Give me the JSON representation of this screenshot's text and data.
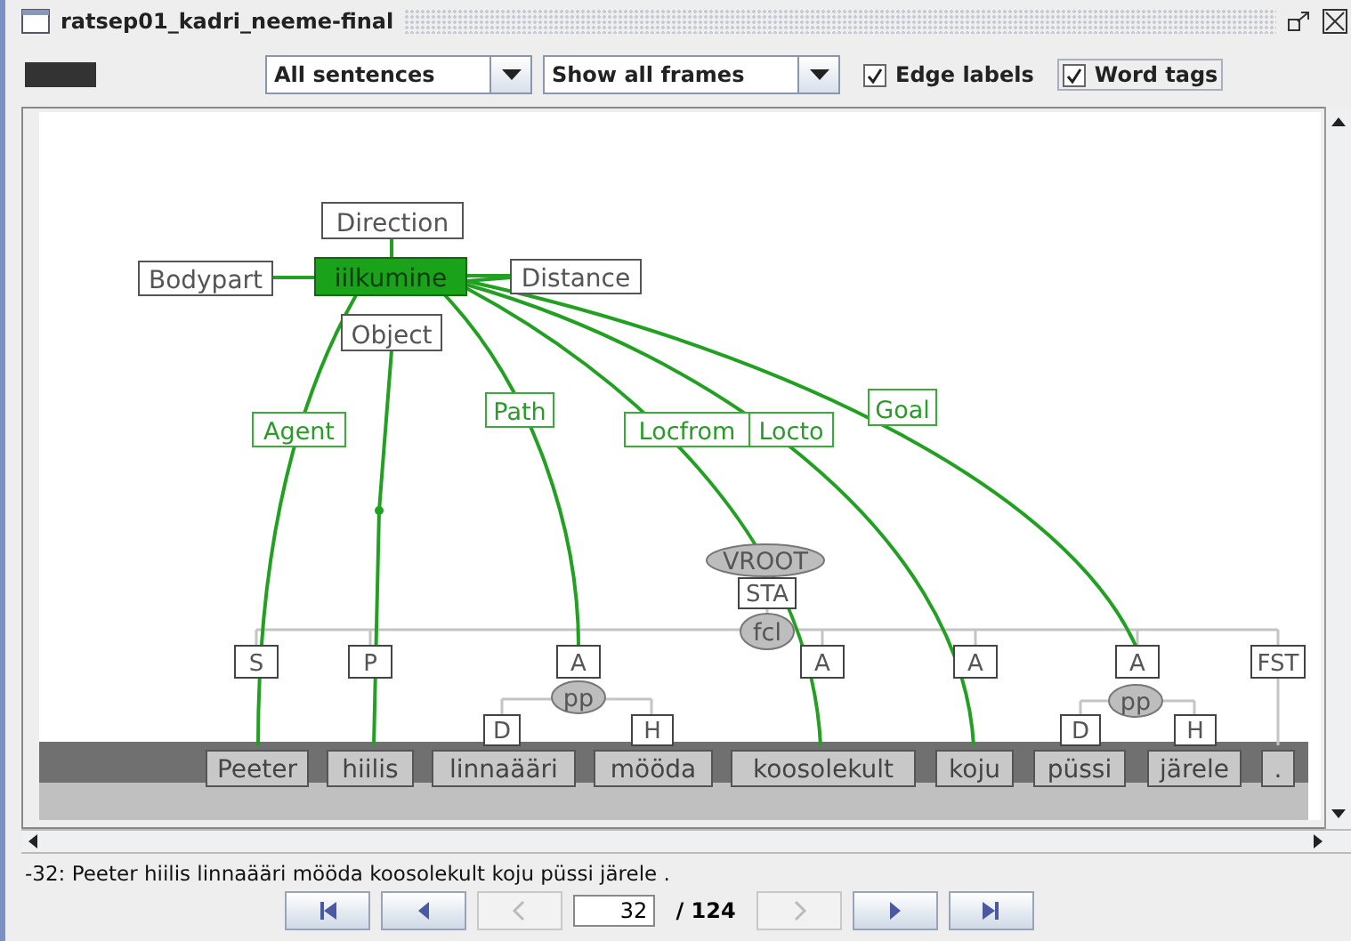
{
  "window": {
    "title": "ratsep01_kadri_neeme-final"
  },
  "toolbar": {
    "dropdowns": [
      {
        "value": "All sentences"
      },
      {
        "value": "Show all frames"
      }
    ],
    "checkboxes": [
      {
        "label": "Edge labels",
        "checked": true,
        "focused": false
      },
      {
        "label": "Word tags",
        "checked": true,
        "focused": true
      }
    ]
  },
  "frame_nodes": [
    {
      "text": "Direction",
      "kind": "element"
    },
    {
      "text": "Bodypart",
      "kind": "element"
    },
    {
      "text": "iilkumine",
      "kind": "frame"
    },
    {
      "text": "Distance",
      "kind": "element"
    },
    {
      "text": "Object",
      "kind": "element"
    }
  ],
  "edge_labels": [
    {
      "text": "Agent"
    },
    {
      "text": "Path"
    },
    {
      "text": "Locfrom"
    },
    {
      "text": "Locto"
    },
    {
      "text": "Goal"
    }
  ],
  "syntax_nodes": [
    {
      "text": "VROOT",
      "kind": "phrase"
    },
    {
      "text": "STA",
      "kind": "function"
    },
    {
      "text": "fcl",
      "kind": "phrase"
    },
    {
      "text": "S",
      "kind": "function"
    },
    {
      "text": "P",
      "kind": "function"
    },
    {
      "text": "A",
      "kind": "function"
    },
    {
      "text": "pp",
      "kind": "phrase"
    },
    {
      "text": "D",
      "kind": "function"
    },
    {
      "text": "H",
      "kind": "function"
    },
    {
      "text": "A",
      "kind": "function"
    },
    {
      "text": "A",
      "kind": "function"
    },
    {
      "text": "A",
      "kind": "function"
    },
    {
      "text": "pp",
      "kind": "phrase"
    },
    {
      "text": "D",
      "kind": "function"
    },
    {
      "text": "H",
      "kind": "function"
    },
    {
      "text": "FST",
      "kind": "function"
    }
  ],
  "words": [
    "Peeter",
    "hiilis",
    "linnaääri",
    "mööda",
    "koosolekult",
    "koju",
    "püssi",
    "järele",
    "."
  ],
  "status": "-32: Peeter hiilis linnaääri mööda koosolekult koju püssi järele .",
  "navigation": {
    "buttons": [
      {
        "kind": "first",
        "disabled": false
      },
      {
        "kind": "prev",
        "disabled": false
      },
      {
        "kind": "prev",
        "disabled": true
      },
      {
        "kind": "field"
      },
      {
        "kind": "next",
        "disabled": true
      },
      {
        "kind": "next",
        "disabled": false
      },
      {
        "kind": "last",
        "disabled": false
      }
    ],
    "page": "32",
    "total": "/ 124"
  }
}
